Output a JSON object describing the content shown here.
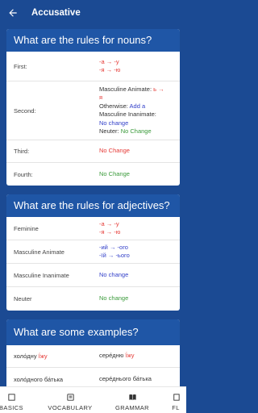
{
  "appbar": {
    "title": "Accusative"
  },
  "nouns": {
    "heading": "What are the rules for nouns?",
    "rows": [
      {
        "label": "First:",
        "lines": [
          {
            "text": "-а → -у",
            "color": "red"
          },
          {
            "text": "-я → -ю",
            "color": "red"
          }
        ]
      },
      {
        "label": "Second:",
        "lines": [
          {
            "parts": [
              {
                "text": "Masculine Animate: ",
                "color": "dark"
              },
              {
                "text": "ь →",
                "color": "red"
              }
            ]
          },
          {
            "parts": [
              {
                "text": "я",
                "color": "red"
              }
            ]
          },
          {
            "parts": [
              {
                "text": "Otherwise: ",
                "color": "dark"
              },
              {
                "text": "Add а",
                "color": "blue"
              }
            ]
          },
          {
            "parts": [
              {
                "text": "Masculine Inanimate:",
                "color": "dark"
              }
            ]
          },
          {
            "parts": [
              {
                "text": "No change",
                "color": "blue"
              }
            ]
          },
          {
            "parts": [
              {
                "text": "Neuter: ",
                "color": "dark"
              },
              {
                "text": "No Change",
                "color": "green"
              }
            ]
          }
        ]
      },
      {
        "label": "Third:",
        "lines": [
          {
            "text": "No Change",
            "color": "red"
          }
        ]
      },
      {
        "label": "Fourth:",
        "lines": [
          {
            "text": "No Change",
            "color": "green"
          }
        ]
      }
    ]
  },
  "adjectives": {
    "heading": "What are the rules for adjectives?",
    "rows": [
      {
        "label": "Feminine",
        "lines": [
          {
            "text": "-а → -у",
            "color": "red"
          },
          {
            "text": "-я → -ю",
            "color": "red"
          }
        ]
      },
      {
        "label": "Masculine Animate",
        "lines": [
          {
            "text": "-ий → -ого",
            "color": "blue"
          },
          {
            "text": "-їй → -ього",
            "color": "blue"
          }
        ]
      },
      {
        "label": "Masculine Inanimate",
        "lines": [
          {
            "text": "No change",
            "color": "blue"
          }
        ]
      },
      {
        "label": "Neuter",
        "lines": [
          {
            "text": "No change",
            "color": "green"
          }
        ]
      }
    ]
  },
  "examples": {
    "heading": "What are some examples?",
    "rows": [
      {
        "left": [
          {
            "text": "холо́дну",
            "color": "dark"
          },
          {
            "text": " ї́жу",
            "color": "red"
          }
        ],
        "right": [
          {
            "text": "серéдню",
            "color": "dark"
          },
          {
            "text": " ї́жу",
            "color": "red"
          }
        ]
      },
      {
        "left": [
          {
            "text": "холо́дного",
            "color": "dark"
          },
          {
            "text": " ба́тька",
            "color": "dark"
          }
        ],
        "right": [
          {
            "text": "серéднього",
            "color": "dark"
          },
          {
            "text": " ба́тька",
            "color": "dark"
          }
        ]
      }
    ]
  },
  "nav": {
    "items": [
      {
        "label": "BASICS",
        "icon": "basics-icon"
      },
      {
        "label": "VOCABULARY",
        "icon": "vocabulary-icon"
      },
      {
        "label": "GRAMMAR",
        "icon": "grammar-icon"
      },
      {
        "label": "FL",
        "icon": "flashcards-icon"
      }
    ]
  },
  "colors": {
    "primary": "#1b4a93",
    "header": "#1f56a6",
    "red": "#e53935",
    "blue": "#3340c9",
    "green": "#3a9a3a"
  }
}
